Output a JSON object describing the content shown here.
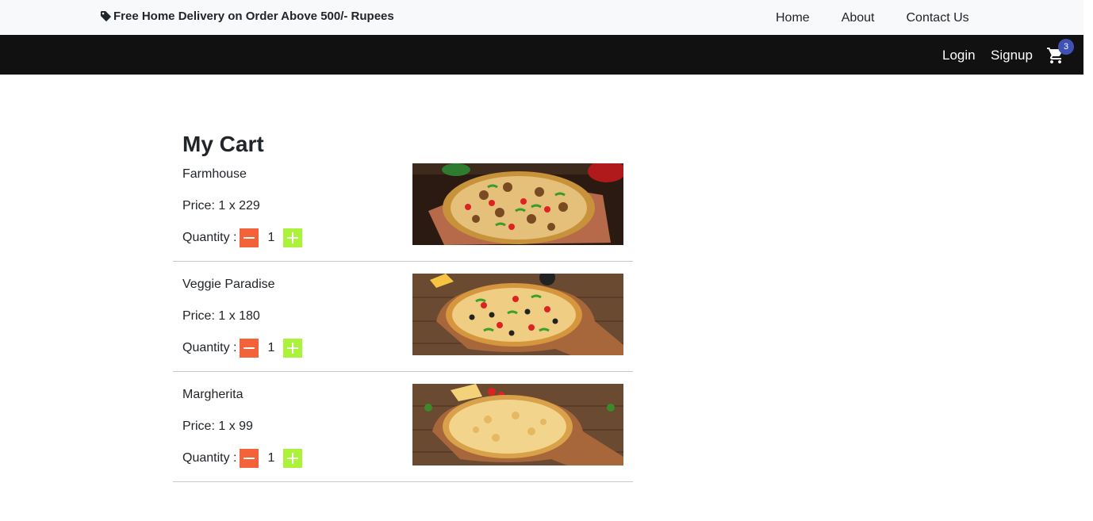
{
  "promo": {
    "text": "Free Home Delivery on Order Above 500/- Rupees",
    "icon": "tag-icon"
  },
  "top_nav": [
    "Home",
    "About",
    "Contact Us"
  ],
  "auth": {
    "login": "Login",
    "signup": "Signup"
  },
  "cart": {
    "icon": "cart-icon",
    "count": "3",
    "badge_color": "#3f51b5"
  },
  "page": {
    "title": "My Cart"
  },
  "items": [
    {
      "name": "Farmhouse",
      "price": "Price: 1 x 229",
      "quantity_label": "Quantity :",
      "quantity": "1",
      "image": "farmhouse-pizza-image"
    },
    {
      "name": "Veggie Paradise",
      "price": "Price: 1 x 180",
      "quantity_label": "Quantity :",
      "quantity": "1",
      "image": "veggie-paradise-pizza-image"
    },
    {
      "name": "Margherita",
      "price": "Price: 1 x 99",
      "quantity_label": "Quantity :",
      "quantity": "1",
      "image": "margherita-pizza-image"
    }
  ],
  "colors": {
    "minus_button": "#f4623a",
    "plus_button": "#aaf33a",
    "dark_bar": "#111111",
    "top_bar": "#f8f9fa"
  }
}
